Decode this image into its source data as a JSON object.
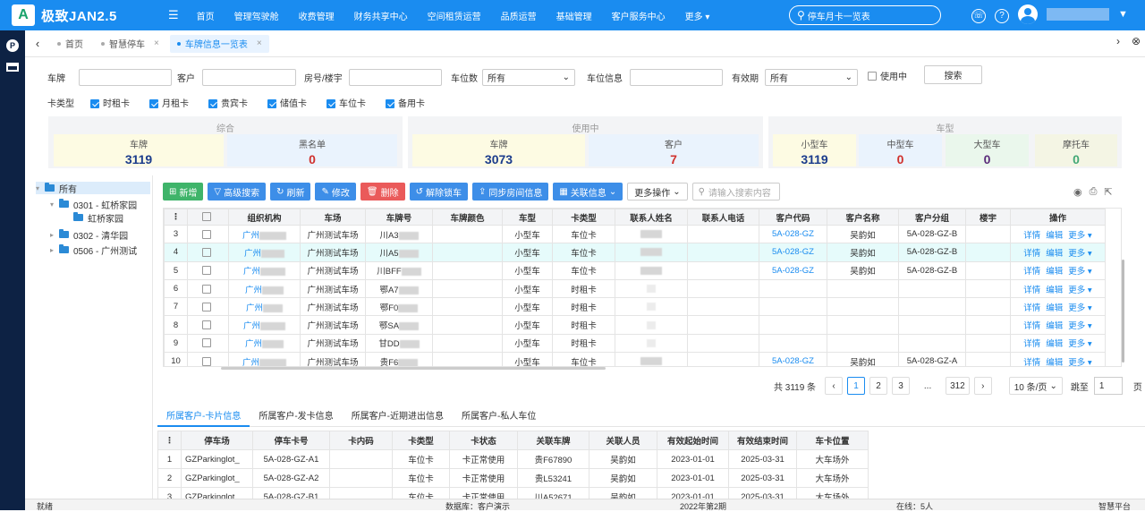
{
  "app": {
    "logo_letter": "A",
    "title": "极致JAN2.5"
  },
  "nav": [
    "首页",
    "管理驾驶舱",
    "收费管理",
    "财务共享中心",
    "空间租赁运营",
    "品质运营",
    "基础管理",
    "客户服务中心",
    "更多 ▾"
  ],
  "search": {
    "value": "停车月卡一览表"
  },
  "tabs": [
    {
      "label": "首页",
      "closable": false,
      "active": false
    },
    {
      "label": "智慧停车",
      "closable": true,
      "active": false
    },
    {
      "label": "车牌信息一览表",
      "closable": true,
      "active": true
    }
  ],
  "filters": {
    "plate_label": "车牌",
    "customer_label": "客户",
    "room_label": "房号/楼宇",
    "spaces_label": "车位数",
    "spaces_value": "所有",
    "space_info_label": "车位信息",
    "validity_label": "有效期",
    "validity_value": "所有",
    "in_use_label": "使用中",
    "search_button": "搜索",
    "card_type_label": "卡类型",
    "card_types": [
      "时租卡",
      "月租卡",
      "贵宾卡",
      "储值卡",
      "车位卡",
      "备用卡"
    ]
  },
  "stats": {
    "comprehensive": {
      "title": "综合",
      "cards": [
        {
          "label": "车牌",
          "value": "3119"
        },
        {
          "label": "黑名单",
          "value": "0"
        }
      ]
    },
    "in_use": {
      "title": "使用中",
      "cards": [
        {
          "label": "车牌",
          "value": "3073"
        },
        {
          "label": "客户",
          "value": "7"
        }
      ]
    },
    "car_type": {
      "title": "车型",
      "cards": [
        {
          "label": "小型车",
          "value": "3119"
        },
        {
          "label": "中型车",
          "value": "0"
        },
        {
          "label": "大型车",
          "value": "0"
        },
        {
          "label": "摩托车",
          "value": "0"
        }
      ]
    }
  },
  "tree": {
    "root": "所有",
    "nodes": [
      "0301 - 虹桥家园",
      "虹桥家园",
      "0302 - 清华园",
      "0506 - 广州测试"
    ]
  },
  "toolbar": {
    "add": "新增",
    "adv_search": "高级搜索",
    "refresh": "刷新",
    "edit": "修改",
    "delete": "删除",
    "unlock": "解除锁车",
    "sync_room": "同步房间信息",
    "link_info": "关联信息",
    "more_ops": "更多操作",
    "search_placeholder": "请输入搜索内容"
  },
  "grid": {
    "columns": [
      "⋮",
      "",
      "组织机构",
      "车场",
      "车牌号",
      "车牌颜色",
      "车型",
      "卡类型",
      "联系人姓名",
      "联系人电话",
      "客户代码",
      "客户名称",
      "客户分组",
      "楼宇",
      "操作"
    ],
    "rows": [
      {
        "no": "3",
        "org": "广州",
        "lot": "广州测试车场",
        "plate": "川A3",
        "type": "小型车",
        "card": "车位卡",
        "cust_code": "5A-028-GZ",
        "cust_name": "吴韵如",
        "group": "5A-028-GZ-B"
      },
      {
        "no": "4",
        "org": "广州",
        "lot": "广州测试车场",
        "plate": "川A5",
        "type": "小型车",
        "card": "车位卡",
        "cust_code": "5A-028-GZ",
        "cust_name": "吴韵如",
        "group": "5A-028-GZ-B"
      },
      {
        "no": "5",
        "org": "广州",
        "lot": "广州测试车场",
        "plate": "川BFF",
        "type": "小型车",
        "card": "车位卡",
        "cust_code": "5A-028-GZ",
        "cust_name": "吴韵如",
        "group": "5A-028-GZ-B"
      },
      {
        "no": "6",
        "org": "广州",
        "lot": "广州测试车场",
        "plate": "鄂A7",
        "type": "小型车",
        "card": "时租卡",
        "cust_code": "",
        "cust_name": "",
        "group": ""
      },
      {
        "no": "7",
        "org": "广州",
        "lot": "广州测试车场",
        "plate": "鄂F0",
        "type": "小型车",
        "card": "时租卡",
        "cust_code": "",
        "cust_name": "",
        "group": ""
      },
      {
        "no": "8",
        "org": "广州",
        "lot": "广州测试车场",
        "plate": "鄂SA",
        "type": "小型车",
        "card": "时租卡",
        "cust_code": "",
        "cust_name": "",
        "group": ""
      },
      {
        "no": "9",
        "org": "广州",
        "lot": "广州测试车场",
        "plate": "甘DD",
        "type": "小型车",
        "card": "时租卡",
        "cust_code": "",
        "cust_name": "",
        "group": ""
      },
      {
        "no": "10",
        "org": "广州",
        "lot": "广州测试车场",
        "plate": "贵F6",
        "type": "小型车",
        "card": "车位卡",
        "cust_code": "5A-028-GZ",
        "cust_name": "吴韵如",
        "group": "5A-028-GZ-A"
      }
    ],
    "ops": {
      "detail": "详情",
      "edit": "编辑",
      "more": "更多 ▾"
    }
  },
  "pager": {
    "total": "共 3119 条",
    "pages": [
      "1",
      "2",
      "3",
      "...",
      "312"
    ],
    "page_size": "10 条/页",
    "goto_label": "跳至",
    "goto_value": "1",
    "page_suffix": "页"
  },
  "bottom_tabs": [
    "所属客户-卡片信息",
    "所属客户-发卡信息",
    "所属客户-近期进出信息",
    "所属客户-私人车位"
  ],
  "bottom_grid": {
    "columns": [
      "⋮",
      "停车场",
      "停车卡号",
      "卡内码",
      "卡类型",
      "卡状态",
      "关联车牌",
      "关联人员",
      "有效起始时间",
      "有效结束时间",
      "车卡位置"
    ],
    "rows": [
      {
        "no": "1",
        "lot": "GZParkinglot_",
        "card_no": "5A-028-GZ-A1",
        "inner": "",
        "type": "车位卡",
        "status": "卡正常使用",
        "plate": "贵F67890",
        "person": "吴韵如",
        "start": "2023-01-01",
        "end": "2025-03-31",
        "pos": "大车场外"
      },
      {
        "no": "2",
        "lot": "GZParkinglot_",
        "card_no": "5A-028-GZ-A2",
        "inner": "",
        "type": "车位卡",
        "status": "卡正常使用",
        "plate": "贵L53241",
        "person": "吴韵如",
        "start": "2023-01-01",
        "end": "2025-03-31",
        "pos": "大车场外"
      },
      {
        "no": "3",
        "lot": "GZParkinglot_",
        "card_no": "5A-028-GZ-B1",
        "inner": "",
        "type": "车位卡",
        "status": "卡正常使用",
        "plate": "川A52671",
        "person": "吴韵如",
        "start": "2023-01-01",
        "end": "2025-03-31",
        "pos": "大车场外"
      }
    ]
  },
  "status": {
    "ready": "就绪",
    "db": "数据库：客户演示",
    "period": "2022年第2期",
    "online": "在线：5人",
    "platform": "智慧平台"
  },
  "colors": {
    "primary": "#1a8cf0",
    "sidebar": "#0d2244",
    "green_btn": "#3fb46a",
    "red_btn": "#ea5a5a"
  }
}
